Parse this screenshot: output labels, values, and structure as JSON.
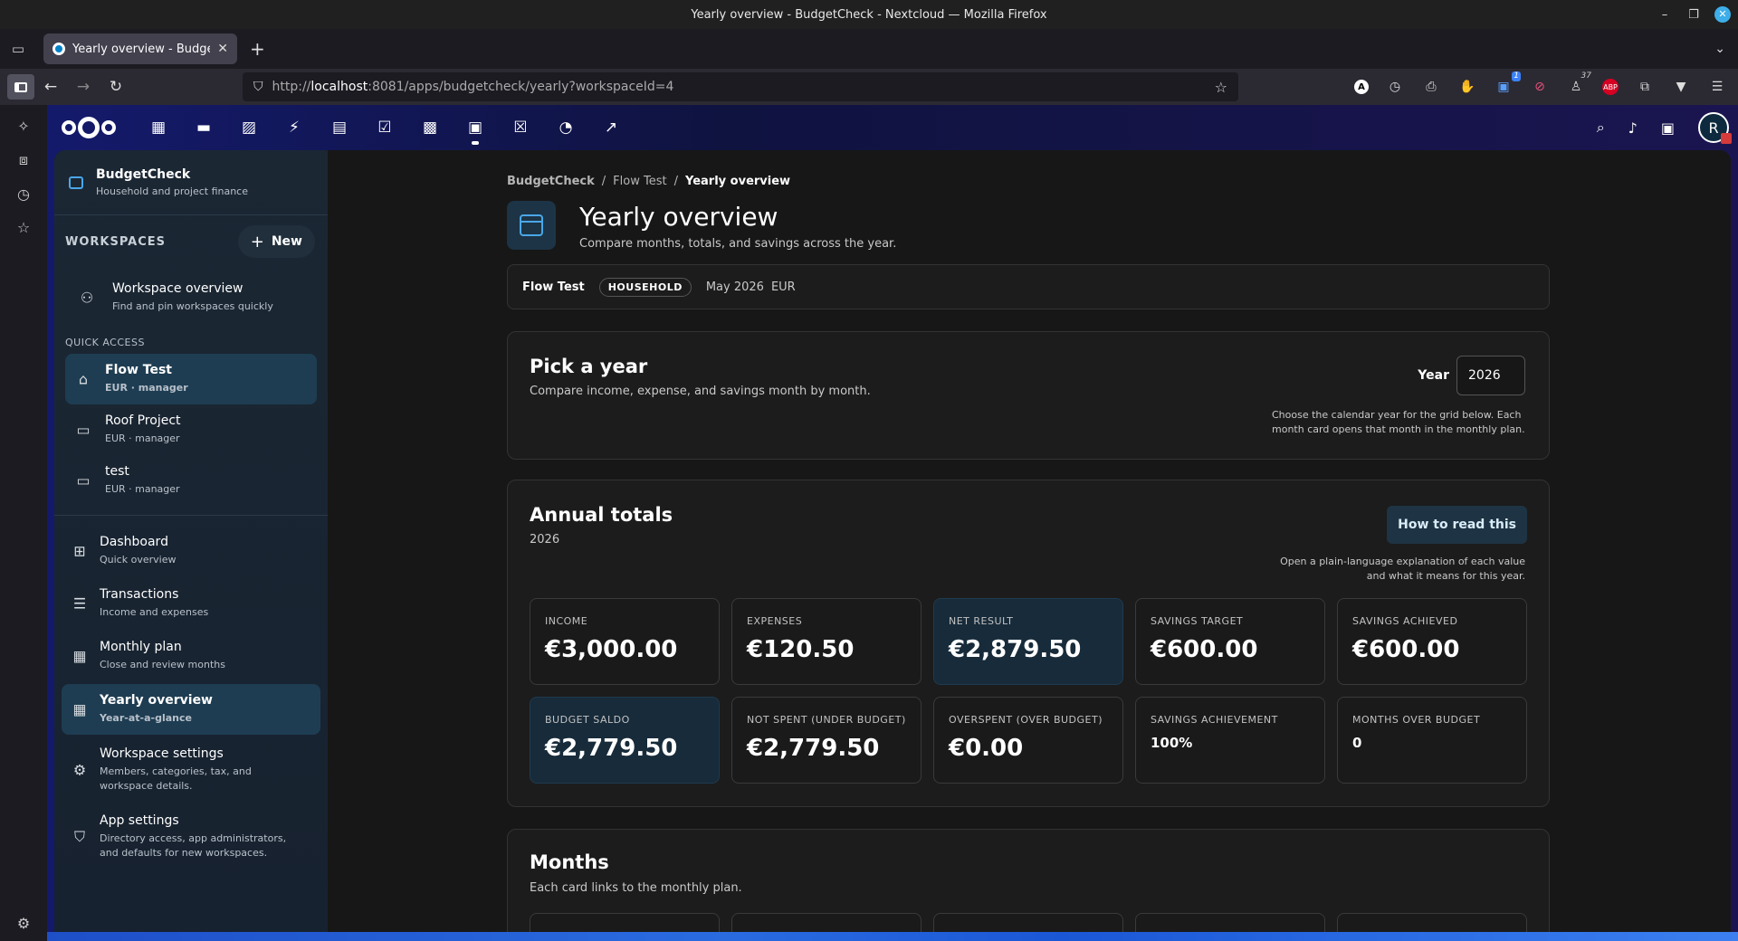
{
  "window": {
    "title": "Yearly overview - BudgetCheck - Nextcloud — Mozilla Firefox"
  },
  "browser": {
    "tab_title": "Yearly overview - BudgetCh",
    "url_prefix": "http://",
    "url_host": "localhost",
    "url_rest": ":8081/apps/budgetcheck/yearly?workspaceId=4",
    "ext_badge_1": "1",
    "ext_badge_2": "37",
    "ext_abp": "ABP"
  },
  "header": {
    "avatar_letter": "R"
  },
  "app": {
    "name": "BudgetCheck",
    "tagline": "Household and project finance"
  },
  "sidebar": {
    "workspaces_label": "WORKSPACES",
    "new_label": "New",
    "overview": {
      "label": "Workspace overview",
      "sub": "Find and pin workspaces quickly"
    },
    "quick_access_label": "QUICK ACCESS",
    "workspaces": [
      {
        "label": "Flow Test",
        "sub": "EUR · manager"
      },
      {
        "label": "Roof Project",
        "sub": "EUR · manager"
      },
      {
        "label": "test",
        "sub": "EUR · manager"
      }
    ],
    "nav": [
      {
        "label": "Dashboard",
        "sub": "Quick overview"
      },
      {
        "label": "Transactions",
        "sub": "Income and expenses"
      },
      {
        "label": "Monthly plan",
        "sub": "Close and review months"
      },
      {
        "label": "Yearly overview",
        "sub": "Year-at-a-glance"
      },
      {
        "label": "Workspace settings",
        "sub": "Members, categories, tax, and workspace details."
      },
      {
        "label": "App settings",
        "sub": "Directory access, app administrators, and defaults for new workspaces."
      }
    ]
  },
  "breadcrumb": {
    "app": "BudgetCheck",
    "workspace": "Flow Test",
    "current": "Yearly overview",
    "sep": "/"
  },
  "page": {
    "title": "Yearly overview",
    "subtitle": "Compare months, totals, and savings across the year."
  },
  "context": {
    "workspace": "Flow Test",
    "type": "HOUSEHOLD",
    "period": "May 2026",
    "currency": "EUR"
  },
  "pick_year": {
    "title": "Pick a year",
    "subtitle": "Compare income, expense, and savings month by month.",
    "year_label": "Year",
    "year_value": "2026",
    "help": "Choose the calendar year for the grid below. Each month card opens that month in the monthly plan."
  },
  "annual": {
    "title": "Annual totals",
    "year": "2026",
    "how_button": "How to read this",
    "how_help": "Open a plain-language explanation of each value and what it means for this year.",
    "stats": [
      {
        "label": "INCOME",
        "value": "€3,000.00"
      },
      {
        "label": "EXPENSES",
        "value": "€120.50"
      },
      {
        "label": "NET RESULT",
        "value": "€2,879.50"
      },
      {
        "label": "SAVINGS TARGET",
        "value": "€600.00"
      },
      {
        "label": "SAVINGS ACHIEVED",
        "value": "€600.00"
      },
      {
        "label": "BUDGET SALDO",
        "value": "€2,779.50"
      },
      {
        "label": "NOT SPENT (UNDER BUDGET)",
        "value": "€2,779.50"
      },
      {
        "label": "OVERSPENT (OVER BUDGET)",
        "value": "€0.00"
      },
      {
        "label": "SAVINGS ACHIEVEMENT",
        "value": "100%"
      },
      {
        "label": "MONTHS OVER BUDGET",
        "value": "0"
      }
    ]
  },
  "months": {
    "title": "Months",
    "subtitle": "Each card links to the monthly plan."
  }
}
